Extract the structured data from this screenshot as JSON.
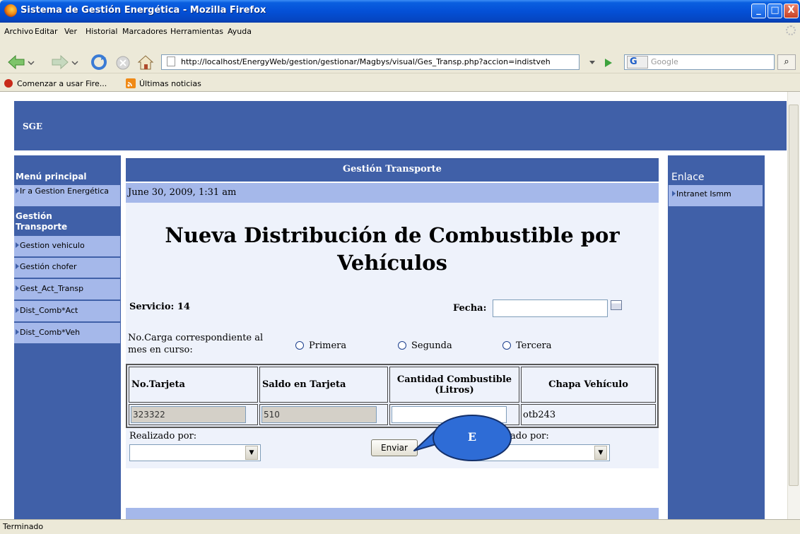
{
  "window": {
    "title": "Sistema de Gestión Energética - Mozilla Firefox",
    "controls": {
      "minimize": "_",
      "maximize": "□",
      "close": "X"
    }
  },
  "menubar": {
    "items": [
      "Archivo",
      "Editar",
      "Ver",
      "Historial",
      "Marcadores",
      "Herramientas",
      "Ayuda"
    ]
  },
  "navbar": {
    "url": "http://localhost/EnergyWeb/gestion/gestionar/Magbys/visual/Ges_Transp.php?accion=indistveh",
    "search_placeholder": "Google",
    "search_engine_label": "G"
  },
  "bookmarks": {
    "items": [
      "Comenzar a usar Fire...",
      "Últimas noticias"
    ]
  },
  "page": {
    "header_title": "SGE",
    "left_menu": {
      "main_heading": "Menú principal",
      "main_link": "Ir a Gestion Energética",
      "section_heading": "Gestión Transporte",
      "items": [
        "Gestion vehiculo",
        "Gestión chofer",
        "Gest_Act_Transp",
        "Dist_Comb*Act",
        "Dist_Comb*Veh"
      ]
    },
    "center": {
      "section_title": "Gestión Transporte",
      "date": "June 30, 2009, 1:31 am",
      "form_title": "Nueva Distribución de Combustible por Vehículos",
      "servicio_label": "Servicio: 14",
      "fecha_label": "Fecha:",
      "fecha_value": "",
      "carga_label": "No.Carga correspondiente al mes en curso:",
      "radio_options": [
        "Primera",
        "Segunda",
        "Tercera"
      ],
      "table": {
        "headers": [
          "No.Tarjeta",
          "Saldo en Tarjeta",
          "Cantidad Combustible (Litros)",
          "Chapa Vehículo"
        ],
        "row": [
          "323322",
          "510",
          "",
          "otb243"
        ]
      },
      "realizado_label": "Realizado por:",
      "aprobado_label_partial": "ado por:",
      "send_button": "Enviar",
      "callout_label": "E"
    },
    "right_menu": {
      "heading": "Enlace",
      "items": [
        "Intranet Ismm"
      ]
    }
  },
  "statusbar": {
    "text": "Terminado"
  }
}
